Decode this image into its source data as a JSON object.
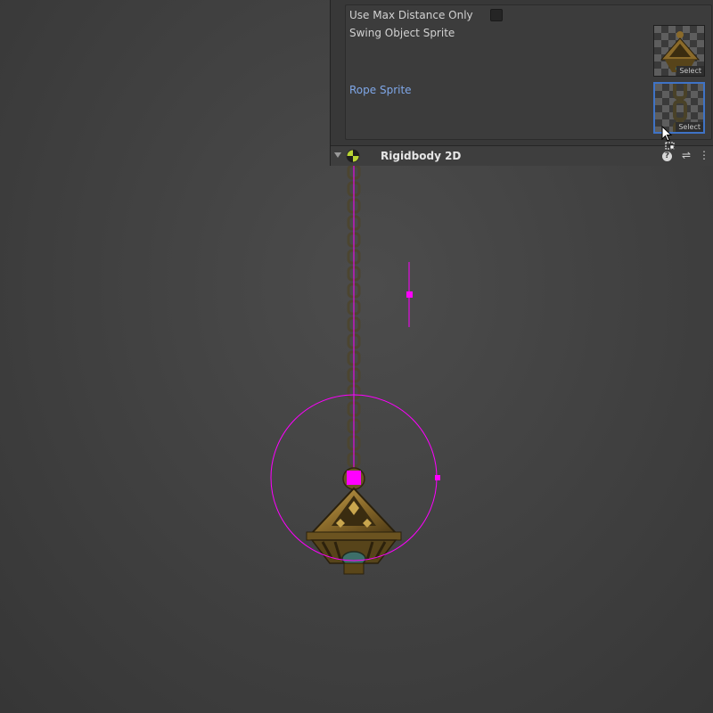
{
  "inspector": {
    "use_max_distance_label": "Use Max Distance Only",
    "use_max_distance_checked": false,
    "swing_object_sprite_label": "Swing Object Sprite",
    "rope_sprite_label": "Rope Sprite",
    "select_label": "Select",
    "component_title": "Rigidbody 2D"
  },
  "icons": {
    "foldout": "triangle-down-icon",
    "component": "rigidbody-2d-icon",
    "help": "help-icon",
    "preset": "preset-sliders-icon",
    "menu": "kebab-menu-icon",
    "cursor": "drag-cursor-icon"
  },
  "colors": {
    "gizmo": "#ff00ff",
    "selection": "#3f73c6",
    "accent_label": "#7fa7e8",
    "panel": "#383838"
  }
}
